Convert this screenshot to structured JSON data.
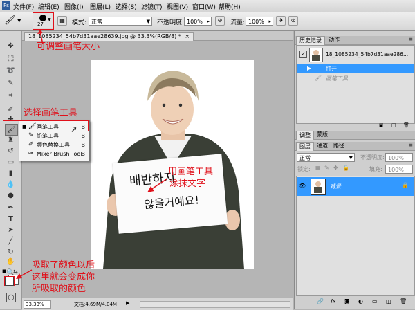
{
  "menu": [
    "文件(F)",
    "编辑(E)",
    "图像(I)",
    "图层(L)",
    "选择(S)",
    "滤镜(T)",
    "视图(V)",
    "窗口(W)",
    "帮助(H)"
  ],
  "options": {
    "brush_size": "27",
    "mode_label": "模式:",
    "mode_value": "正常",
    "opacity_label": "不透明度:",
    "opacity_value": "100%",
    "flow_label": "流量:",
    "flow_value": "100%"
  },
  "document": {
    "tab_title": "18_1085234_54b7d31aae28639.jpg @ 33.3%(RGB/8) *",
    "close_glyph": "×",
    "photo_text_line1": "배반하지",
    "photo_text_line2": "않을거예요!"
  },
  "status": {
    "zoom": "33.33%",
    "doc_info": "文档:4.69M/4.04M"
  },
  "tool_flyout": {
    "items": [
      {
        "label": "画笔工具",
        "key": "B",
        "icon": "brush-icon"
      },
      {
        "label": "铅笔工具",
        "key": "B",
        "icon": "pencil-icon"
      },
      {
        "label": "颜色替换工具",
        "key": "B",
        "icon": "color-replace-icon"
      },
      {
        "label": "Mixer Brush Tool",
        "key": "B",
        "icon": "mixer-brush-icon"
      }
    ]
  },
  "history_panel": {
    "tabs": [
      "历史记录",
      "动作"
    ],
    "snapshot_name": "18_1085234_54b7d31aae286...",
    "states": [
      "打开",
      "画笔工具"
    ]
  },
  "adjust_panel": {
    "tabs": [
      "调整",
      "蒙版"
    ]
  },
  "layers_panel": {
    "tabs": [
      "图层",
      "通道",
      "路径"
    ],
    "blend_mode": "正常",
    "opacity_label": "不透明度:",
    "opacity_value": "100%",
    "lock_label": "锁定:",
    "fill_label": "填充:",
    "fill_value": "100%",
    "layer_name": "背景"
  },
  "annotations": {
    "brush_size": "可调整画笔大小",
    "select_brush": "选择画笔工具",
    "paint_text_line1": "用画笔工具",
    "paint_text_line2": "涂抹文字",
    "color_line1": "吸取了颜色以后",
    "color_line2": "这里就会变成你",
    "color_line3": "所吸取的颜色"
  },
  "colors": {
    "annotation_red": "#e0101a",
    "selection_blue": "#3399ff",
    "foreground_swatch": "#000000",
    "background_swatch": "#ffffff"
  }
}
